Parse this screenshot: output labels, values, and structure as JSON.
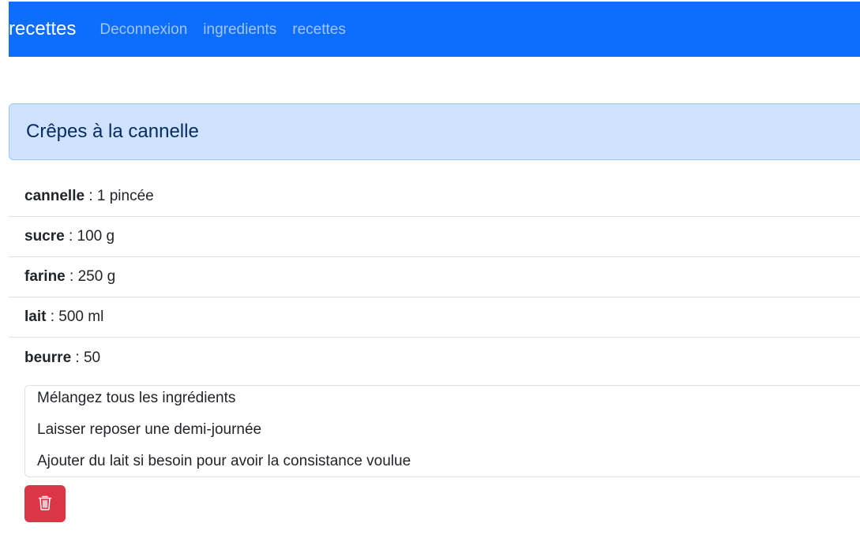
{
  "navbar": {
    "brand": "recettes",
    "links": [
      "Deconnexion",
      "ingredients",
      "recettes"
    ],
    "color": "#0d6efd"
  },
  "recipe": {
    "title": "Crêpes à la cannelle",
    "ingredients": [
      {
        "name": "cannelle",
        "quantity": " : 1 pincée"
      },
      {
        "name": "sucre",
        "quantity": " : 100 g"
      },
      {
        "name": "farine",
        "quantity": " : 250 g"
      },
      {
        "name": "lait",
        "quantity": " : 500 ml"
      },
      {
        "name": "beurre",
        "quantity": " : 50"
      }
    ],
    "steps": [
      "Mélangez tous les ingrédients",
      "Laisser reposer une demi-journée",
      "Ajouter du lait si besoin pour avoir la consistance voulue"
    ]
  },
  "actions": {
    "delete_icon": "trash-icon",
    "delete_color": "#dc3545"
  }
}
